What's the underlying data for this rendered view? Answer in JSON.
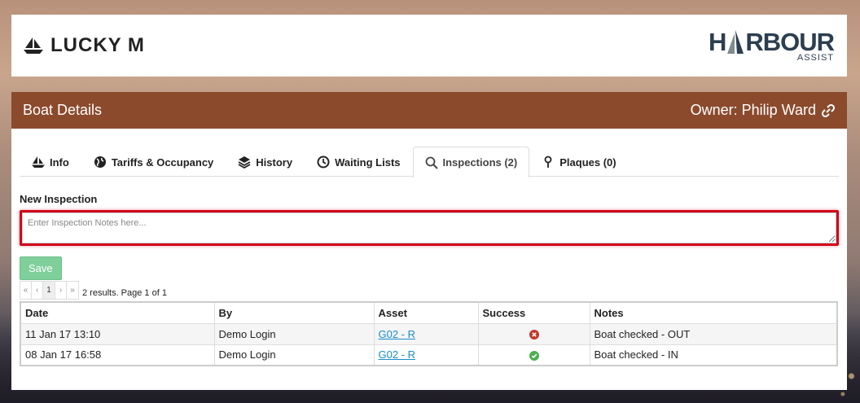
{
  "header": {
    "boat_name": "LUCKY M",
    "logo_brand_left": "H",
    "logo_brand_right": "RBOUR",
    "logo_sub": "ASSIST"
  },
  "panel": {
    "title": "Boat Details",
    "owner": "Owner: Philip Ward"
  },
  "tabs": [
    {
      "label": "Info",
      "icon": "sailboat-icon"
    },
    {
      "label": "Tariffs & Occupancy",
      "icon": "globe-icon"
    },
    {
      "label": "History",
      "icon": "layers-icon"
    },
    {
      "label": "Waiting Lists",
      "icon": "clock-icon"
    },
    {
      "label": "Inspections (2)",
      "icon": "search-icon",
      "active": true
    },
    {
      "label": "Plaques (0)",
      "icon": "map-marker-icon"
    }
  ],
  "inspection": {
    "section_label": "New Inspection",
    "notes_placeholder": "Enter Inspection Notes here...",
    "save_label": "Save"
  },
  "pager": {
    "first": "«",
    "prev": "‹",
    "page": "1",
    "next": "›",
    "last": "»",
    "info": "2 results. Page 1 of 1"
  },
  "table": {
    "headers": [
      "Date",
      "By",
      "Asset",
      "Success",
      "Notes"
    ],
    "rows": [
      {
        "date": "11 Jan 17 13:10",
        "by": "Demo Login",
        "asset": "G02 - R",
        "success": "fail",
        "notes": "Boat checked - OUT"
      },
      {
        "date": "08 Jan 17 16:58",
        "by": "Demo Login",
        "asset": "G02 - R",
        "success": "ok",
        "notes": "Boat checked - IN"
      }
    ]
  },
  "colors": {
    "panel_header": "#8b4a2c",
    "save_button": "#7fcf9a",
    "highlight_border": "#d0021b",
    "link": "#1a8ec9",
    "fail": "#c0392b",
    "ok": "#4caf50"
  }
}
